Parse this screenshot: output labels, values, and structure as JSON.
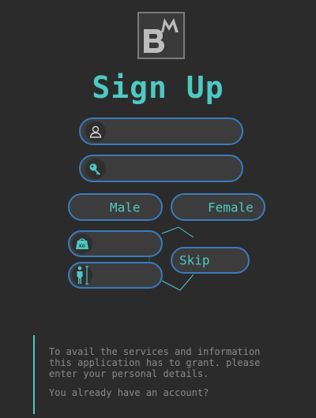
{
  "logo": {
    "text": "BM"
  },
  "page": {
    "title": "Sign Up"
  },
  "fields": {
    "name_value": "",
    "password_value": "",
    "weight_value": "",
    "height_value": ""
  },
  "icons": {
    "name": "user-icon",
    "password": "key-icon",
    "weight": "weight-scale-icon",
    "height": "person-height-icon"
  },
  "gender": {
    "male_label": "Male",
    "female_label": "Female"
  },
  "skip": {
    "label": "Skip"
  },
  "info": {
    "description": "To avail the services and information this application has to grant. please enter your personal details.",
    "account_link": "You already have an account?"
  },
  "colors": {
    "background": "#2b2b2b",
    "accent": "#4ec9c3",
    "border": "#3a7bbf",
    "field": "#3c3c3c",
    "muted_text": "#8a8a8a"
  }
}
